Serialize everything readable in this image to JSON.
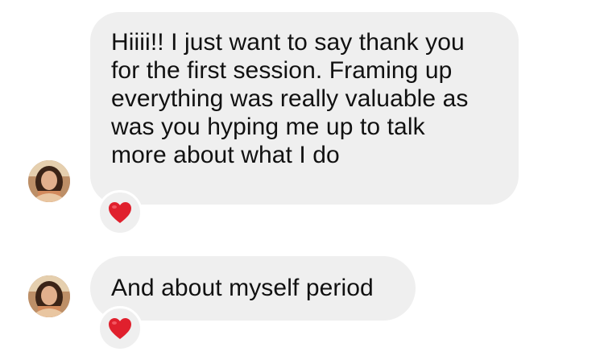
{
  "messages": [
    {
      "lines": [
        "Hiiii!! I just want to say thank you",
        "for the first session. Framing up",
        "everything was really valuable as",
        "was you hyping me up to talk",
        "more about what I do"
      ],
      "reaction": "heart-icon"
    },
    {
      "lines": [
        "And about myself period"
      ],
      "reaction": "heart-icon"
    }
  ],
  "colors": {
    "bubble": "#efefef",
    "text": "#111111",
    "heart": "#e0202d"
  }
}
